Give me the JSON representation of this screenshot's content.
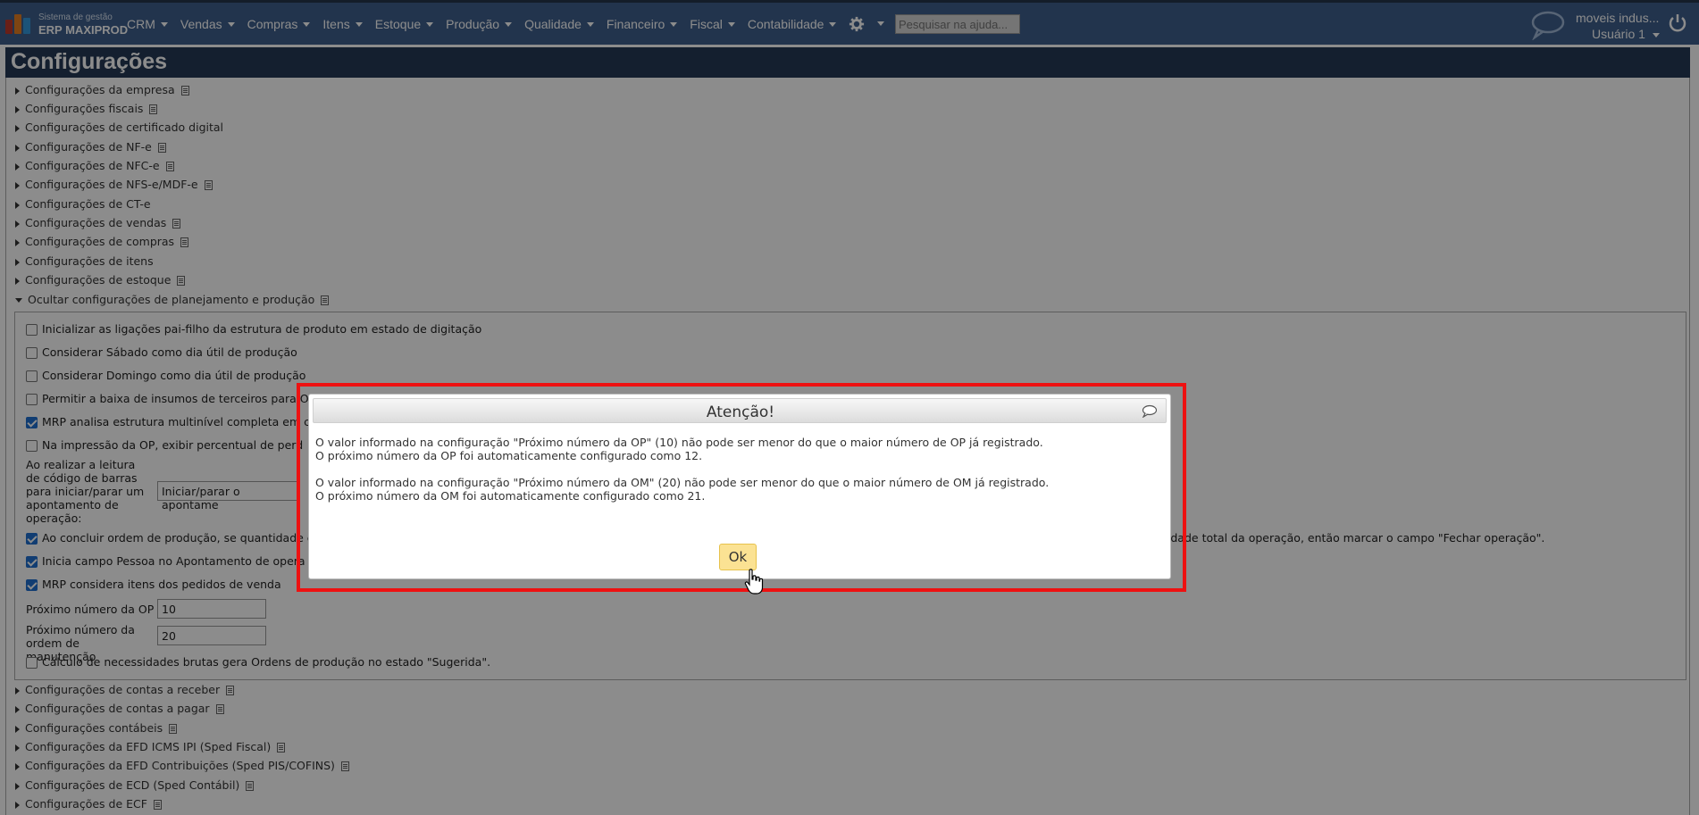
{
  "app": {
    "logo_line1": "Sistema de gestão",
    "logo_line2": "ERP MAXIPROD",
    "logo_colors": [
      "#c0392b",
      "#e67e22",
      "#3498db",
      "#2c3e50"
    ]
  },
  "menu": [
    "CRM",
    "Vendas",
    "Compras",
    "Itens",
    "Estoque",
    "Produção",
    "Qualidade",
    "Financeiro",
    "Fiscal",
    "Contabilidade"
  ],
  "search": {
    "placeholder": "Pesquisar na ajuda..."
  },
  "user": {
    "company": "moveis indus...",
    "name": "Usuário 1"
  },
  "page": {
    "title": "Configurações"
  },
  "sections_top": [
    "Configurações da empresa",
    "Configurações fiscais",
    "Configurações de certificado digital",
    "Configurações de NF-e",
    "Configurações de NFC-e",
    "Configurações de NFS-e/MDF-e",
    "Configurações de CT-e",
    "Configurações de vendas",
    "Configurações de compras",
    "Configurações de itens",
    "Configurações de estoque"
  ],
  "section_open": "Ocultar configurações de planejamento e produção",
  "options": {
    "opt1": "Inicializar as ligações pai-filho da estrutura de produto em estado de digitação",
    "opt2": "Considerar Sábado como dia útil de produção",
    "opt3": "Considerar Domingo como dia útil de produção",
    "opt4": "Permitir a baixa de insumos de terceiros para O",
    "opt5": "MRP analisa estrutura multinível completa em c",
    "opt6": "Na impressão da OP, exibir percentual de perd",
    "barcode_label": "Ao realizar a leitura de código de barras para iniciar/parar um apontamento de operação:",
    "barcode_value": "Iniciar/parar o apontame",
    "opt7": "Ao concluir ordem de produção, se quantidade c",
    "opt7_tail": "tidade total da operação, então marcar o campo \"Fechar operação\".",
    "opt8": "Inicia campo Pessoa no Apontamento de opera",
    "opt9": "MRP considera itens dos pedidos de venda",
    "next_op_label": "Próximo número da OP",
    "next_op_value": "10",
    "next_om_label": "Próximo número da ordem de manutenção",
    "next_om_value": "20",
    "opt10": "Cálculo de necessidades brutas gera Ordens de produção no estado \"Sugerida\"."
  },
  "sections_bottom": [
    "Configurações de contas a receber",
    "Configurações de contas a pagar",
    "Configurações contábeis",
    "Configurações da EFD ICMS IPI (Sped Fiscal)",
    "Configurações da EFD Contribuições (Sped PIS/COFINS)",
    "Configurações de ECD (Sped Contábil)",
    "Configurações de ECF"
  ],
  "dialog": {
    "title": "Atenção!",
    "line1": "O valor informado na configuração \"Próximo número da OP\" (10) não pode ser menor do que o maior número de OP já registrado.",
    "line2": "O próximo número da OP foi automaticamente configurado como 12.",
    "line3": "O valor informado na configuração \"Próximo número da OM\" (20) não pode ser menor do que o maior número de OM já registrado.",
    "line4": "O próximo número da OM foi automaticamente configurado como 21.",
    "ok": "Ok"
  }
}
